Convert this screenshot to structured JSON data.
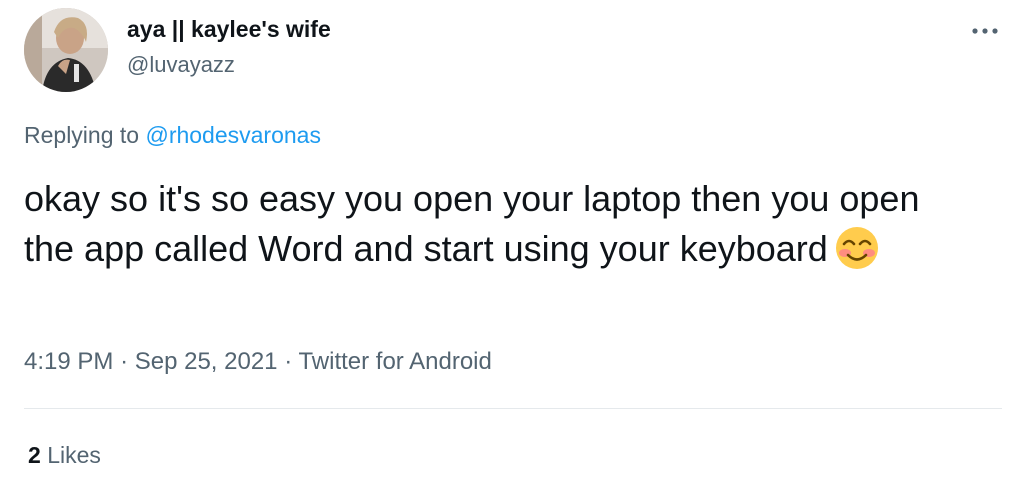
{
  "author": {
    "display_name": "aya || kaylee's wife",
    "handle": "@luvayazz",
    "avatar_icon": "profile-photo"
  },
  "more_icon": "more-horizontal-icon",
  "reply_context": {
    "prefix": "Replying to",
    "mention": "@rhodesvaronas"
  },
  "tweet": {
    "text": "okay so it's so easy you open your laptop then you open the app called Word and start using your keyboard",
    "emoji": "smiling-face-with-smiling-eyes",
    "emoji_glyph": "😊"
  },
  "meta": {
    "time": "4:19 PM",
    "separator1": "·",
    "date": "Sep 25, 2021",
    "separator2": "·",
    "source": "Twitter for Android"
  },
  "stats": {
    "likes_count": "2",
    "likes_label": "Likes"
  },
  "colors": {
    "text_primary": "#0f1419",
    "text_secondary": "#536471",
    "link": "#1d9bf0",
    "divider": "#e5e9ec"
  }
}
